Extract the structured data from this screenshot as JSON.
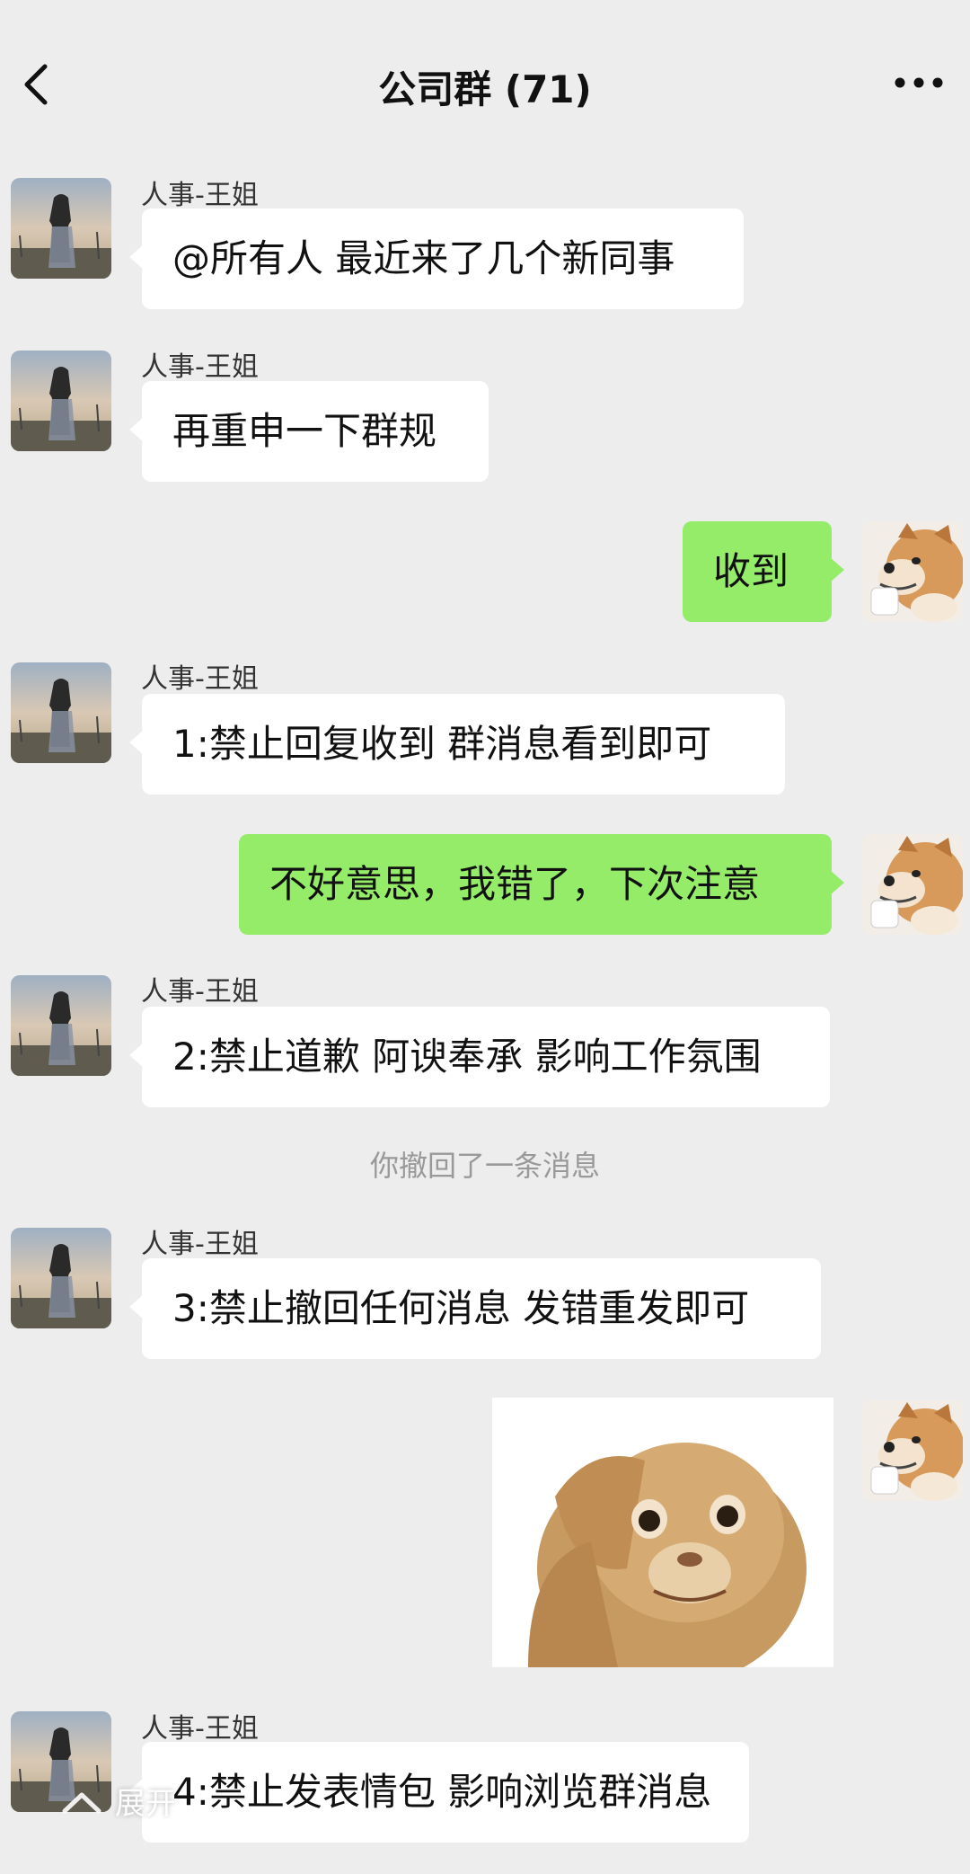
{
  "header": {
    "title": "公司群 (71)"
  },
  "messages": [
    {
      "sender": "人事-王姐",
      "text": "@所有人 最近来了几个新同事"
    },
    {
      "sender": "人事-王姐",
      "text": "再重申一下群规"
    },
    {
      "text": "收到"
    },
    {
      "sender": "人事-王姐",
      "text": "1:禁止回复收到  群消息看到即可"
    },
    {
      "text": "不好意思，我错了，下次注意"
    },
    {
      "sender": "人事-王姐",
      "text": "2:禁止道歉 阿谀奉承 影响工作氛围"
    },
    {
      "sender": "人事-王姐",
      "text": "3:禁止撤回任何消息 发错重发即可"
    },
    {
      "sender": "人事-王姐",
      "text": "4:禁止发表情包 影响浏览群消息"
    }
  ],
  "system": {
    "recall_notice": "你撤回了一条消息"
  },
  "overlay": {
    "expand_label": "展开"
  }
}
